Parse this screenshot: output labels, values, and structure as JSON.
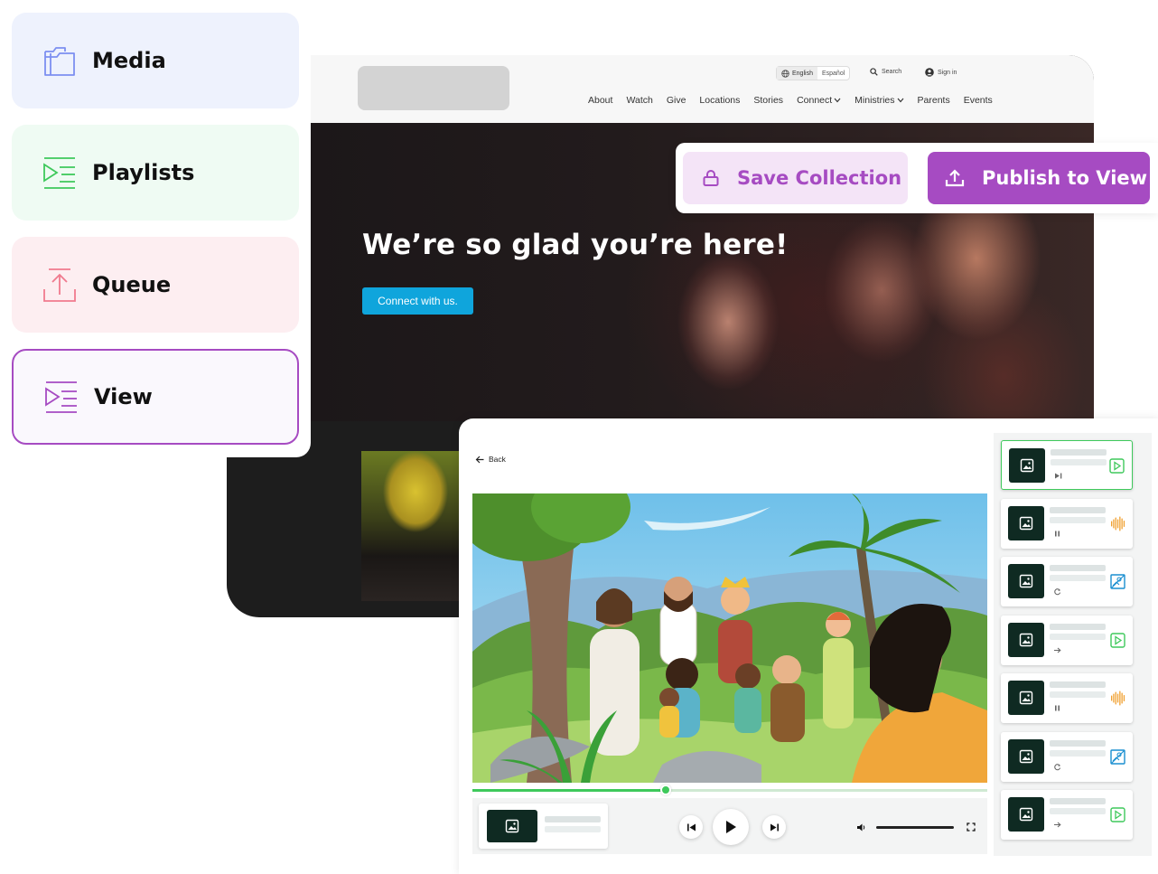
{
  "site": {
    "lang": {
      "active": "English",
      "other": "Español"
    },
    "search_label": "Search",
    "signin_label": "Sign in",
    "nav": [
      "About",
      "Watch",
      "Give",
      "Locations",
      "Stories",
      "Connect",
      "Ministries",
      "Parents",
      "Events"
    ],
    "nav_dropdowns": [
      "Connect",
      "Ministries"
    ],
    "hero_title": "We’re so glad you’re here!",
    "hero_button": "Connect with us.",
    "hero_button_color": "#0fa5dc"
  },
  "sidebar": {
    "items": [
      {
        "label": "Media",
        "icon": "folder-icon",
        "color": "#7c8ff0"
      },
      {
        "label": "Playlists",
        "icon": "playlist-icon",
        "color": "#3ec95b"
      },
      {
        "label": "Queue",
        "icon": "upload-icon",
        "color": "#f07a8e"
      },
      {
        "label": "View",
        "icon": "playlist-icon",
        "color": "#a64bc2",
        "selected": true
      }
    ]
  },
  "actions": {
    "save_label": "Save Collection",
    "publish_label": "Publish to View",
    "accent": "#a64bc2"
  },
  "player": {
    "back_label": "Back",
    "progress": 0.376,
    "volume": 1.0,
    "queue": [
      {
        "type": "video",
        "state": "skip-next",
        "active": true
      },
      {
        "type": "audio",
        "state": "pause",
        "active": false
      },
      {
        "type": "image",
        "state": "loop",
        "active": false
      },
      {
        "type": "video",
        "state": "next",
        "active": false
      },
      {
        "type": "audio",
        "state": "pause",
        "active": false
      },
      {
        "type": "image",
        "state": "loop",
        "active": false
      },
      {
        "type": "video",
        "state": "next",
        "active": false
      }
    ],
    "colors": {
      "video": "#3ec95b",
      "audio": "#f0a030",
      "image": "#1a8fd0"
    }
  }
}
